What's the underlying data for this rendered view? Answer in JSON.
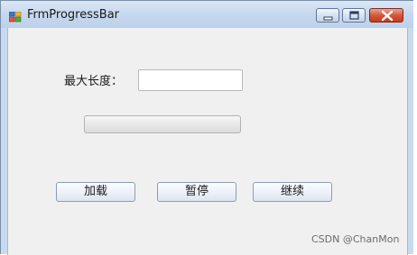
{
  "window": {
    "title": "FrmProgressBar"
  },
  "form": {
    "max_length_label": "最大长度：",
    "max_length_value": "",
    "progress_value": 0
  },
  "buttons": {
    "load": "加载",
    "pause": "暂停",
    "resume": "继续"
  },
  "watermark": "CSDN @ChanMon",
  "colors": {
    "title_bar": "#c6d8ee",
    "close_button": "#c94a2c",
    "client_background": "#f0f0f0",
    "progress_fill": "#5fd04b"
  },
  "icons": {
    "app": "app-icon",
    "minimize": "minimize-icon",
    "maximize": "maximize-icon",
    "close": "close-icon"
  }
}
